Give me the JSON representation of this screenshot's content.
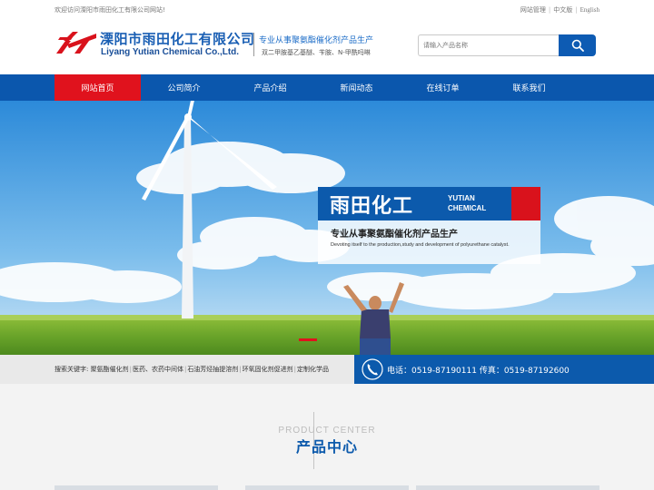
{
  "topbar": {
    "welcome": "欢迎访问溧阳市雨田化工有限公司网站!",
    "links": [
      "网站管理",
      "中文版",
      "English"
    ]
  },
  "header": {
    "company_cn": "溧阳市雨田化工有限公司",
    "company_en": "Liyang Yutian Chemical Co.,Ltd.",
    "slogan": "专业从事聚氨酯催化剂产品生产",
    "slogan_sub": "双二甲胺基乙基醚、苄胺、N-甲酰吗啉"
  },
  "search": {
    "placeholder": "请输入产品名称"
  },
  "nav": {
    "items": [
      "网站首页",
      "公司简介",
      "产品介绍",
      "新闻动态",
      "在线订单",
      "联系我们"
    ],
    "active_index": 0
  },
  "banner": {
    "title_cn": "雨田化工",
    "title_en_line1": "YUTIAN",
    "title_en_line2": "CHEMICAL",
    "subtitle_cn": "专业从事聚氨酯催化剂产品生产",
    "subtitle_en": "Devoting itself to the production,study and development of polyurethane catalyst."
  },
  "keywords": {
    "label": "搜索关键字:",
    "items": [
      "聚氨酯催化剂",
      "医药、农药中间体",
      "石油芳烃抽提溶剂",
      "环氧固化剂促进剂",
      "定制化学品"
    ]
  },
  "contact": {
    "text": "电话：0519-87190111  传真：0519-87192600"
  },
  "product_center": {
    "title_en": "PRODUCT CENTER",
    "title_cn": "产品中心"
  },
  "colors": {
    "brand_blue": "#0c5aac",
    "accent_red": "#e0121d",
    "keyword_bg": "#e9e9e9"
  }
}
